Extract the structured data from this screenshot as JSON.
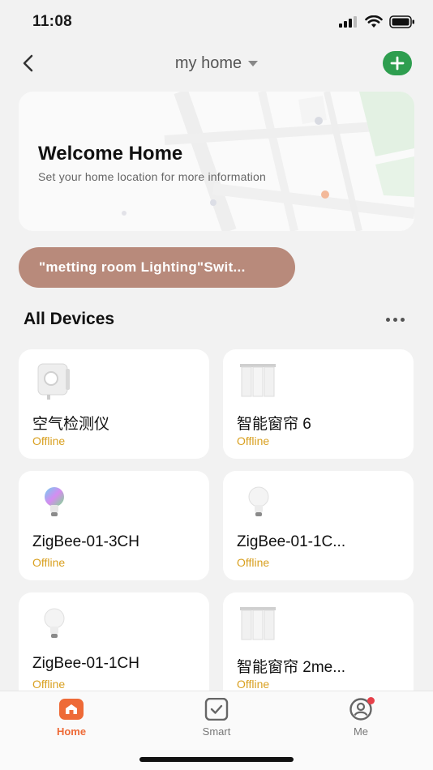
{
  "status_bar": {
    "time": "11:08"
  },
  "nav": {
    "home_name": "my home"
  },
  "welcome": {
    "title": "Welcome Home",
    "subtitle": "Set your home location for more information"
  },
  "scene": {
    "label": "\"metting room Lighting\"Swit..."
  },
  "section": {
    "title": "All Devices"
  },
  "devices": [
    {
      "name": "空气检测仪",
      "status": "Offline",
      "icon": "air-detector-icon"
    },
    {
      "name": "智能窗帘 6",
      "status": "Offline",
      "icon": "curtain-icon"
    },
    {
      "name": "ZigBee-01-3CH",
      "status": "Offline",
      "icon": "rgb-bulb-icon"
    },
    {
      "name": "ZigBee-01-1C...",
      "status": "Offline",
      "icon": "bulb-icon"
    },
    {
      "name": "ZigBee-01-1CH",
      "status": "Offline",
      "icon": "bulb-icon"
    },
    {
      "name": "智能窗帘 2me...",
      "status": "Offline",
      "icon": "curtain-icon"
    }
  ],
  "tabs": [
    {
      "label": "Home",
      "icon": "home-icon",
      "active": true
    },
    {
      "label": "Smart",
      "icon": "checkbox-icon",
      "active": false
    },
    {
      "label": "Me",
      "icon": "profile-icon",
      "active": false
    }
  ],
  "colors": {
    "accent": "#ee6a37",
    "add_button": "#2e9e4f",
    "scene_pill": "#b88a7b",
    "offline": "#d9a020"
  }
}
